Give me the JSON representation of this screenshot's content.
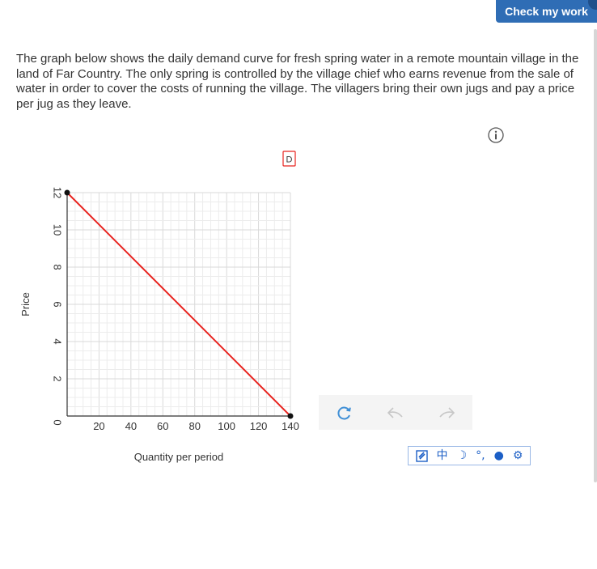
{
  "header": {
    "check_label": "Check my work"
  },
  "prompt": {
    "text": "The graph below shows the daily demand curve for fresh spring water in a remote mountain village in the land of Far Country. The only spring is controlled by the village chief who earns revenue from the sale of water in order to cover the costs of running the village. The villagers bring their own jugs and pay a price per jug as they leave."
  },
  "icons": {
    "info": "info-icon",
    "reset": "reset-icon",
    "undo": "undo-icon",
    "redo": "redo-icon"
  },
  "ime": {
    "items": [
      "中",
      "☽",
      "°,",
      "●",
      "⚙"
    ]
  },
  "chart_data": {
    "type": "line",
    "xlabel": "Quantity per period",
    "ylabel": "Price",
    "xlim": [
      0,
      140
    ],
    "ylim": [
      0,
      12
    ],
    "x_ticks": [
      "20",
      "40",
      "60",
      "80",
      "100",
      "120",
      "140"
    ],
    "y_ticks": [
      "0",
      "2",
      "4",
      "6",
      "8",
      "10",
      "12"
    ],
    "grid": true,
    "legend_label": "D",
    "series": [
      {
        "name": "D",
        "color": "#e8231f",
        "points": [
          [
            0,
            12
          ],
          [
            140,
            0
          ]
        ]
      }
    ]
  }
}
